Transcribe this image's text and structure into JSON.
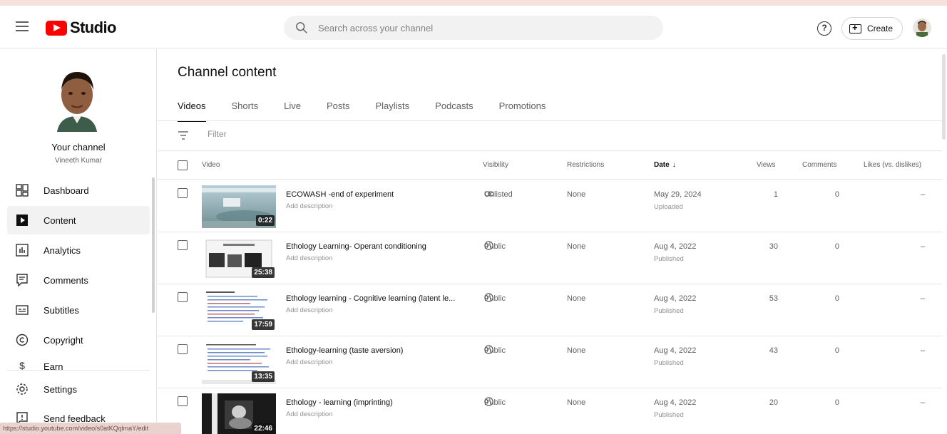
{
  "app": {
    "brand": "Studio"
  },
  "header": {
    "search_placeholder": "Search across your channel",
    "create_label": "Create",
    "help_glyph": "?"
  },
  "sidebar": {
    "your_channel": "Your channel",
    "channel_name": "Vineeth Kumar",
    "items": [
      {
        "label": "Dashboard",
        "icon": "dashboard-icon",
        "active": false
      },
      {
        "label": "Content",
        "icon": "content-icon",
        "active": true
      },
      {
        "label": "Analytics",
        "icon": "analytics-icon",
        "active": false
      },
      {
        "label": "Comments",
        "icon": "comments-icon",
        "active": false
      },
      {
        "label": "Subtitles",
        "icon": "subtitles-icon",
        "active": false
      },
      {
        "label": "Copyright",
        "icon": "copyright-icon",
        "active": false
      },
      {
        "label": "Earn",
        "icon": "earn-icon",
        "active": false
      },
      {
        "label": "Settings",
        "icon": "settings-icon",
        "active": false
      },
      {
        "label": "Send feedback",
        "icon": "feedback-icon",
        "active": false
      }
    ]
  },
  "status_url": "https://studio.youtube.com/video/s0atKQqlmaY/edit",
  "main": {
    "title": "Channel content",
    "tabs": [
      "Videos",
      "Shorts",
      "Live",
      "Posts",
      "Playlists",
      "Podcasts",
      "Promotions"
    ],
    "filter_placeholder": "Filter",
    "columns": {
      "video": "Video",
      "visibility": "Visibility",
      "restrictions": "Restrictions",
      "date": "Date",
      "views": "Views",
      "comments": "Comments",
      "likes": "Likes (vs. dislikes)"
    },
    "rows": [
      {
        "title": "ECOWASH -end of experiment",
        "description": "Add description",
        "duration": "0:22",
        "visibility": "Unlisted",
        "restrictions": "None",
        "date": "May 29, 2024",
        "date_status": "Uploaded",
        "views": "1",
        "comments": "0",
        "likes": "–"
      },
      {
        "title": "Ethology Learning- Operant conditioning",
        "description": "Add description",
        "duration": "25:38",
        "visibility": "Public",
        "restrictions": "None",
        "date": "Aug 4, 2022",
        "date_status": "Published",
        "views": "30",
        "comments": "0",
        "likes": "–"
      },
      {
        "title": "Ethology learning - Cognitive learning (latent le...",
        "description": "Add description",
        "duration": "17:59",
        "visibility": "Public",
        "restrictions": "None",
        "date": "Aug 4, 2022",
        "date_status": "Published",
        "views": "53",
        "comments": "0",
        "likes": "–"
      },
      {
        "title": "Ethology-learning (taste aversion)",
        "description": "Add description",
        "duration": "13:35",
        "visibility": "Public",
        "restrictions": "None",
        "date": "Aug 4, 2022",
        "date_status": "Published",
        "views": "43",
        "comments": "0",
        "likes": "–"
      },
      {
        "title": "Ethology - learning (imprinting)",
        "description": "Add description",
        "duration": "22:46",
        "visibility": "Public",
        "restrictions": "None",
        "date": "Aug 4, 2022",
        "date_status": "Published",
        "views": "20",
        "comments": "0",
        "likes": "–"
      }
    ]
  }
}
